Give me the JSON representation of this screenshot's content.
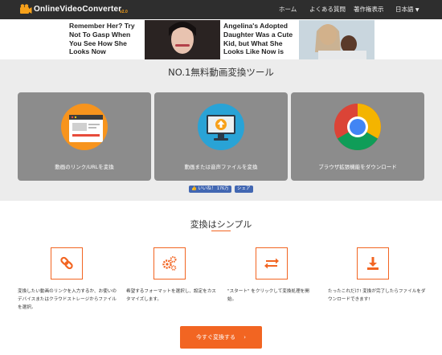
{
  "brand": {
    "name": "OnlineVideoConverter",
    "version": "v2.0",
    "logo_color": "#f7a11a"
  },
  "nav": {
    "items": [
      "ホーム",
      "よくある質問",
      "著作権表示",
      "日本語"
    ]
  },
  "ads": [
    {
      "text": "Remember Her? Try Not To Gasp When You See How She Looks Now"
    },
    {
      "text": "Angelina's Adopted Daughter Was a Cute Kid, but What She Looks Like Now is"
    }
  ],
  "hero": {
    "title": "NO.1無料動画変換ツール",
    "cards": [
      {
        "label": "動画のリンク/URLを変換",
        "icon": "link-convert-icon",
        "color": "#f7941d"
      },
      {
        "label": "動画または音声ファイルを変換",
        "icon": "monitor-upload-icon",
        "color": "#29a3d6"
      },
      {
        "label": "ブラウザ拡張機能をダウンロード",
        "icon": "chrome-icon",
        "color": "#ffffff"
      }
    ],
    "like": {
      "label": "いいね！",
      "count": "176万"
    },
    "share_label": "シェア"
  },
  "simple": {
    "title": "変換はシンプル",
    "steps": [
      {
        "icon": "link-icon",
        "text": "変換したい動画のリンクを入力するか、お使いのデバイスまたはクラウドストレージからファイルを選択。"
      },
      {
        "icon": "settings-gears-icon",
        "text": "希望するフォーマットを選択し、設定をカスタマイズします。"
      },
      {
        "icon": "swap-arrows-icon",
        "text": "\"スタート\" をクリックして変換処理を開始。"
      },
      {
        "icon": "download-icon",
        "text": "たったこれだけ! 変換が完了したらファイルをダウンロードできます!"
      }
    ],
    "cta_label": "今すぐ変換する",
    "cta_arrow": "›"
  },
  "colors": {
    "accent": "#f26522",
    "nav_bg": "#2e2e2e",
    "card_bg": "#8c8c8c",
    "facebook": "#4267b2"
  }
}
